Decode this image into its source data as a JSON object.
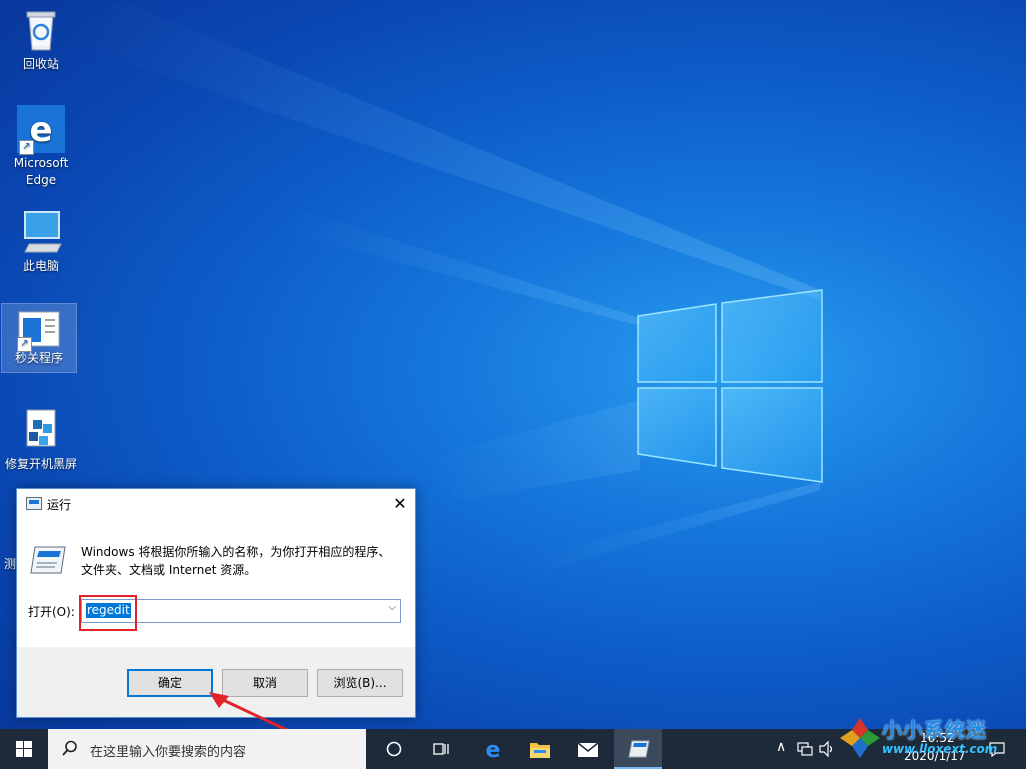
{
  "desktop": {
    "icons": [
      {
        "label": "回收站",
        "icon": "recycle-bin-icon"
      },
      {
        "label": "Microsoft Edge",
        "icon": "edge-icon"
      },
      {
        "label": "此电脑",
        "icon": "computer-icon"
      },
      {
        "label": "秒关程序",
        "icon": "app-icon"
      },
      {
        "label": "修复开机黑屏",
        "icon": "repair-icon"
      }
    ],
    "partial_label": "测"
  },
  "run_dialog": {
    "title": "运行",
    "description": "Windows 将根据你所输入的名称，为你打开相应的程序、文件夹、文档或 Internet 资源。",
    "open_label": "打开(O):",
    "input_value": "regedit",
    "ok_label": "确定",
    "cancel_label": "取消",
    "browse_label": "浏览(B)..."
  },
  "taskbar": {
    "search_placeholder": "在这里输入你要搜索的内容",
    "clock_time": "16:52",
    "clock_date": "2020/1/17"
  },
  "watermark": {
    "title": "小小系统迷",
    "url": "www.lloxext.com"
  },
  "colors": {
    "accent": "#0078d7",
    "highlight_box": "#e0242a",
    "taskbar": "#1c2a3a"
  }
}
